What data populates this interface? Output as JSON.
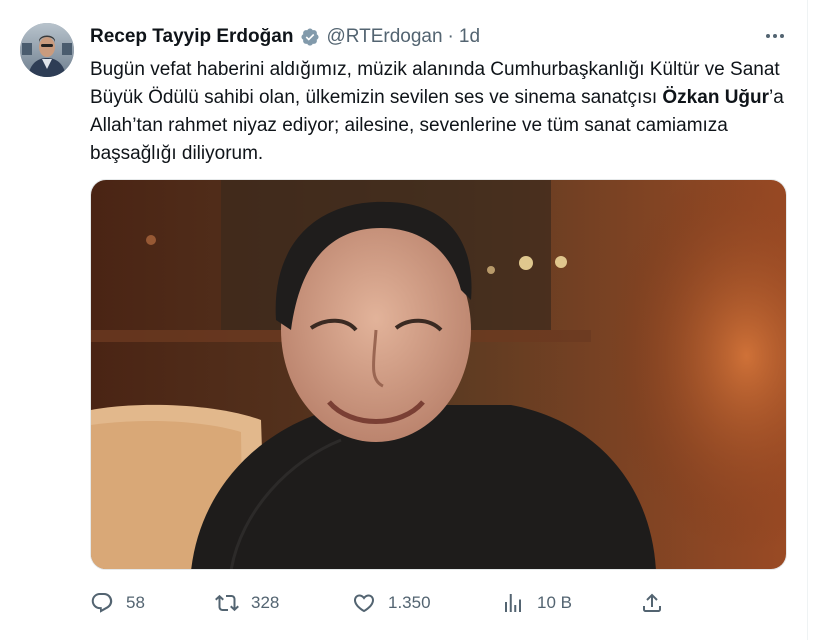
{
  "tweet": {
    "author_name": "Recep Tayyip Erdoğan",
    "handle": "@RTErdogan",
    "separator": "·",
    "time": "1d",
    "text_part1": "Bugün vefat haberini aldığımız, müzik alanında Cumhurbaşkanlığı Kültür ve Sanat Büyük Ödülü sahibi olan, ülkemizin sevilen ses ve sinema sanatçısı ",
    "text_bold": "Özkan Uğur",
    "text_part2": "’a Allah’tan rahmet niyaz ediyor; ailesine, sevenlerine ve tüm sanat camiamıza başsağlığı diliyorum."
  },
  "metrics": {
    "replies": "58",
    "retweets": "328",
    "likes": "1.350",
    "views": "10 B"
  },
  "colors": {
    "verified": "#829aab",
    "text": "#0f1419",
    "secondary": "#536471"
  },
  "icons": [
    "verified-badge-icon",
    "more-icon",
    "reply-icon",
    "retweet-icon",
    "like-icon",
    "views-icon",
    "share-icon"
  ]
}
